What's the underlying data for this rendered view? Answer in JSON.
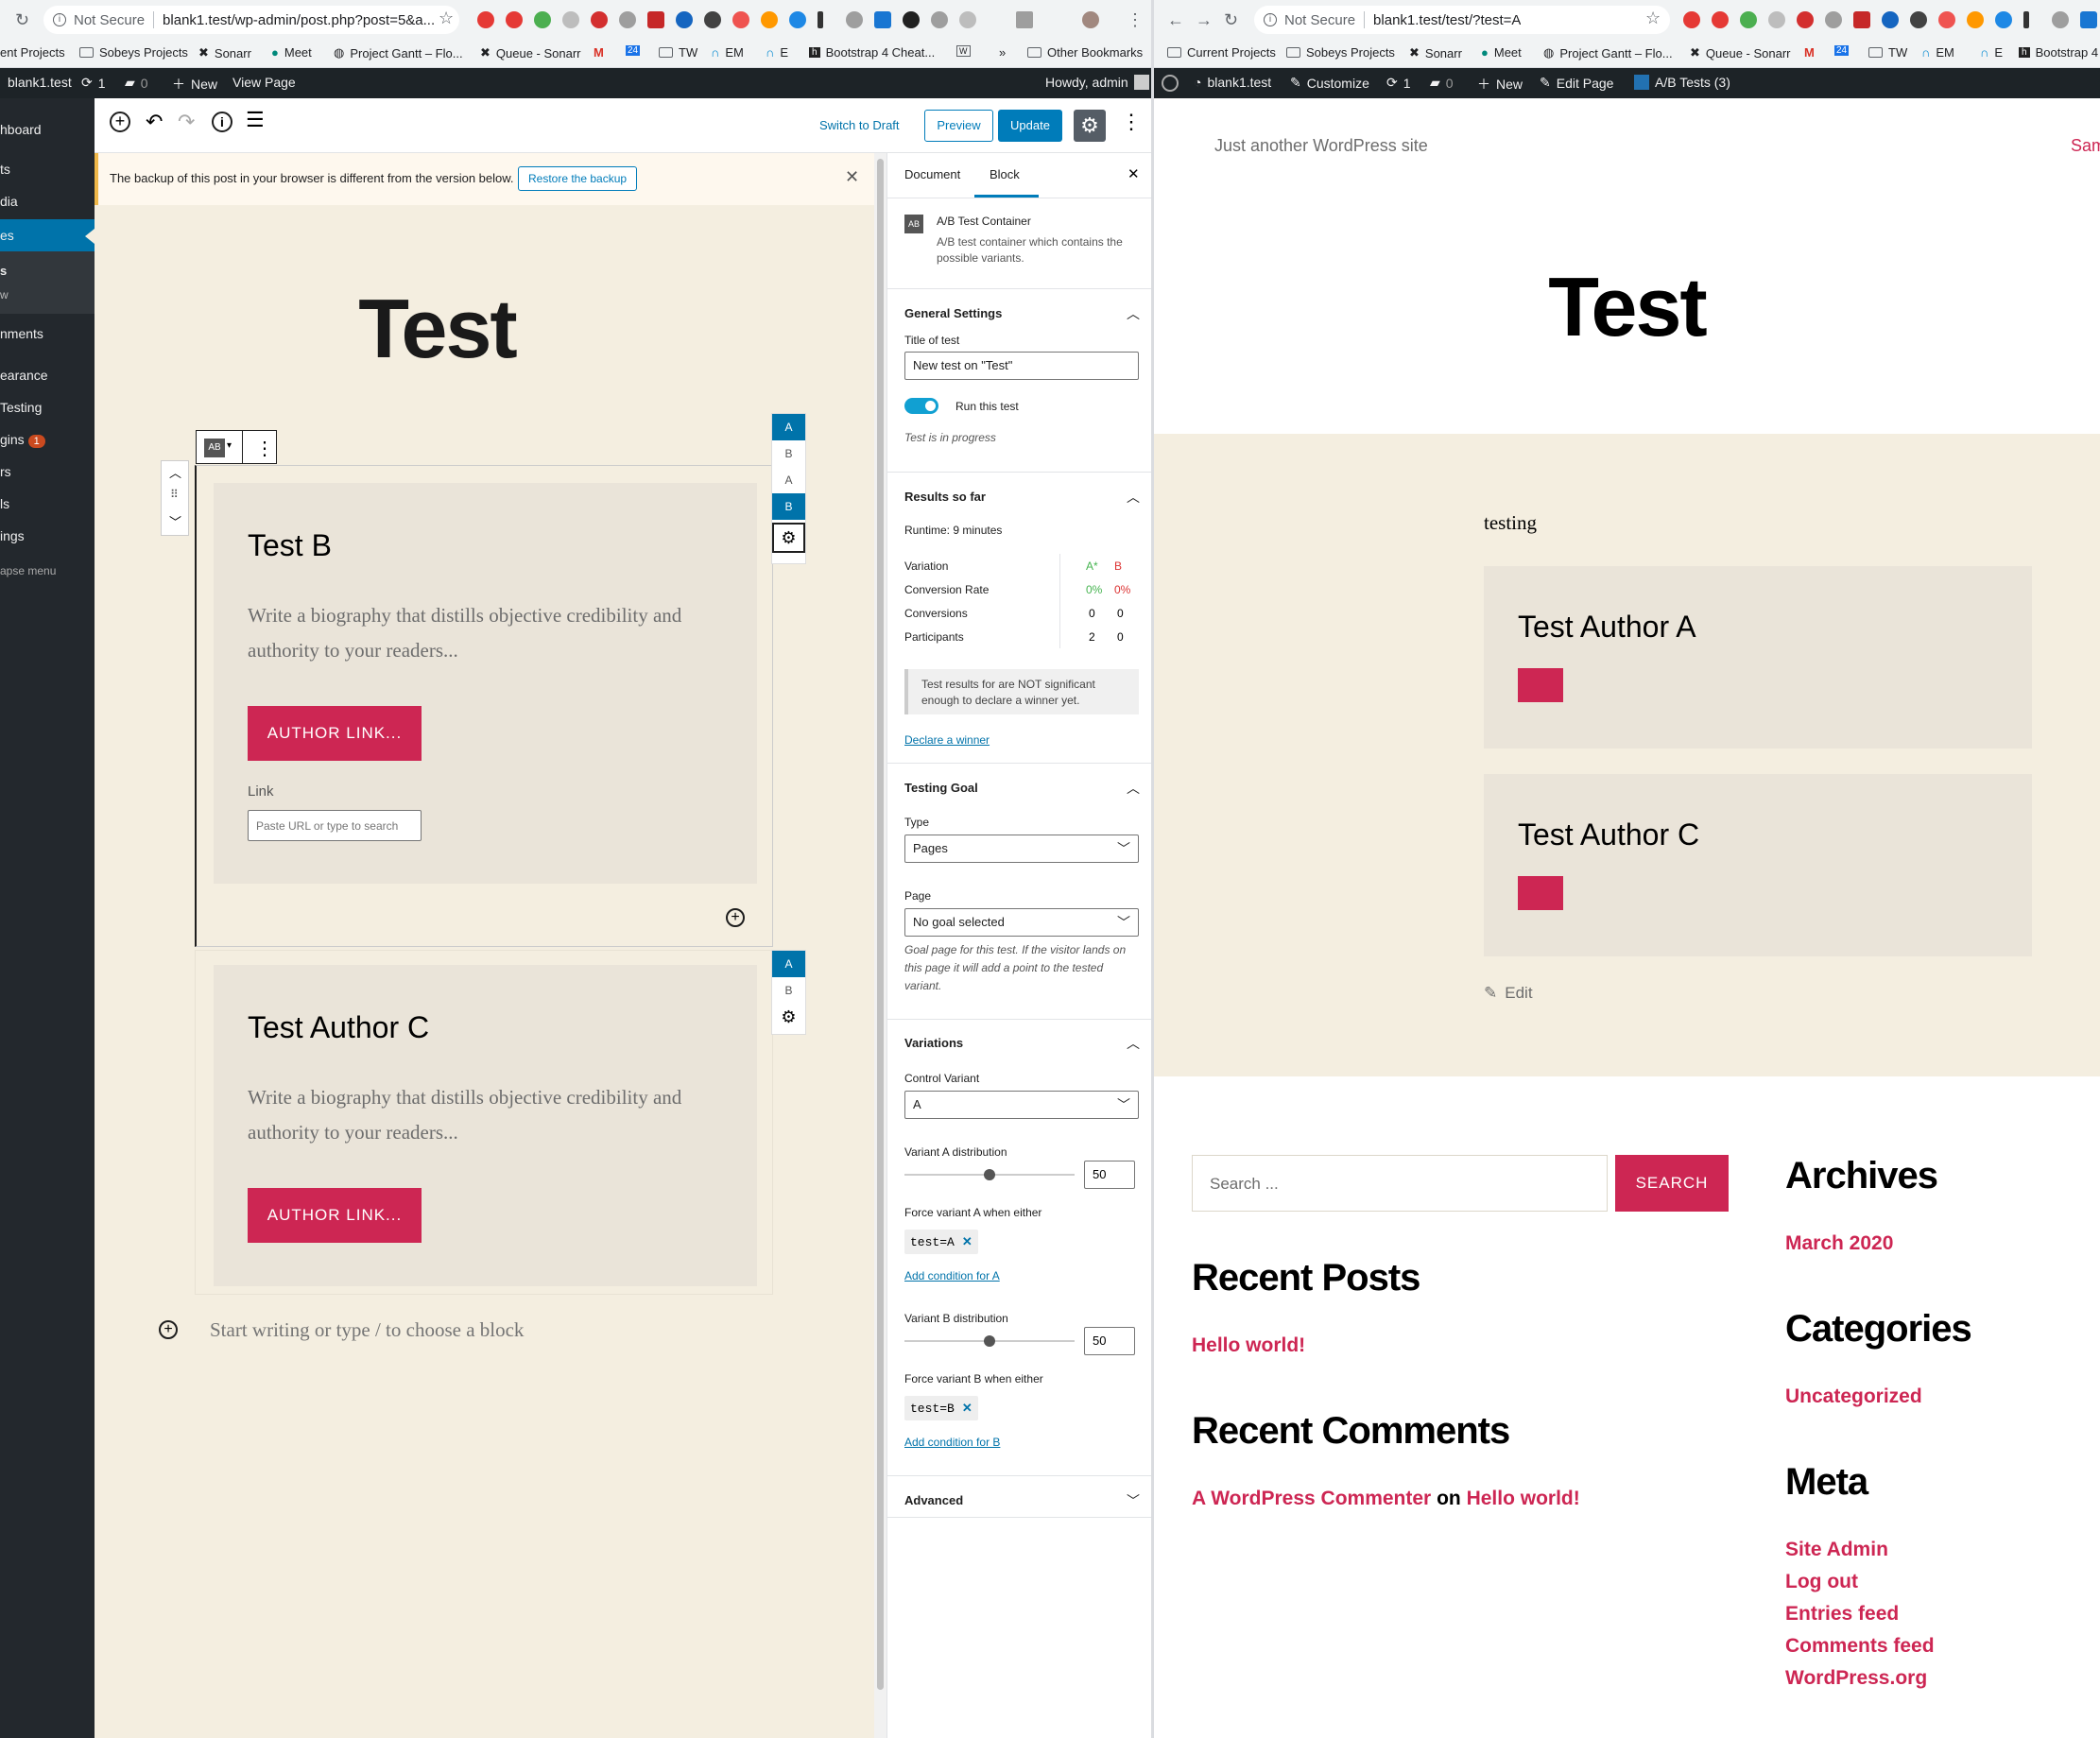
{
  "left_browser": {
    "security": "Not Secure",
    "url": "blank1.test/wp-admin/post.php?post=5&a...",
    "bookmarks": [
      "ent Projects",
      "Sobeys Projects",
      "Sonarr",
      "Meet",
      "Project Gantt – Flo...",
      "Queue - Sonarr",
      "TW",
      "EM",
      "E",
      "Bootstrap 4 Cheat..."
    ],
    "more_bookmarks": "»",
    "other_bookmarks": "Other Bookmarks"
  },
  "right_browser": {
    "security": "Not Secure",
    "url": "blank1.test/test/?test=A",
    "bookmarks": [
      "Current Projects",
      "Sobeys Projects",
      "Sonarr",
      "Meet",
      "Project Gantt – Flo...",
      "Queue - Sonarr",
      "TW",
      "EM",
      "E",
      "Bootstrap 4"
    ]
  },
  "admin_bar_left": {
    "site": "blank1.test",
    "updates": "1",
    "comments": "0",
    "new": "New",
    "view_page": "View Page",
    "howdy": "Howdy, admin"
  },
  "admin_bar_right": {
    "site": "blank1.test",
    "customize": "Customize",
    "updates": "1",
    "comments": "0",
    "new": "New",
    "edit_page": "Edit Page",
    "ab_tests": "A/B Tests (3)"
  },
  "sidebar": {
    "items": [
      "hboard",
      "ts",
      "dia",
      "es",
      "s",
      "w",
      "nments",
      "earance",
      "Testing",
      "gins",
      "rs",
      "ls",
      "ings",
      "apse menu"
    ],
    "plugins_badge": "1"
  },
  "editor_toolbar": {
    "switch_to_draft": "Switch to Draft",
    "preview": "Preview",
    "update": "Update"
  },
  "notice": {
    "text": "The backup of this post in your browser is different from the version below.",
    "restore": "Restore the backup"
  },
  "editor": {
    "post_title": "Test",
    "block_icon": "AB",
    "card_b": {
      "heading": "Test B",
      "bio": "Write a biography that distills objective credibility and authority to your readers...",
      "button": "AUTHOR LINK...",
      "link_label": "Link",
      "link_placeholder": "Paste URL or type to search"
    },
    "card_c": {
      "heading": "Test Author C",
      "bio": "Write a biography that distills objective credibility and authority to your readers...",
      "button": "AUTHOR LINK..."
    },
    "variant_tabs_1": [
      "A",
      "B",
      "A",
      "B"
    ],
    "variant_tabs_2": [
      "A",
      "B"
    ],
    "appender_placeholder": "Start writing or type / to choose a block"
  },
  "inspector": {
    "tab_document": "Document",
    "tab_block": "Block",
    "block_name": "A/B Test Container",
    "block_desc": "A/B test container which contains the possible variants.",
    "general": {
      "heading": "General Settings",
      "title_label": "Title of test",
      "title_value": "New test on \"Test\"",
      "toggle_label": "Run this test",
      "status": "Test is in progress"
    },
    "results": {
      "heading": "Results so far",
      "runtime": "Runtime: 9 minutes",
      "rows": [
        {
          "label": "Variation",
          "a": "A*",
          "b": "B"
        },
        {
          "label": "Conversion Rate",
          "a": "0%",
          "b": "0%"
        },
        {
          "label": "Conversions",
          "a": "0",
          "b": "0"
        },
        {
          "label": "Participants",
          "a": "2",
          "b": "0"
        }
      ],
      "note": "Test results for are NOT significant enough to declare a winner yet.",
      "declare": "Declare a winner"
    },
    "goal": {
      "heading": "Testing Goal",
      "type_label": "Type",
      "type_value": "Pages",
      "page_label": "Page",
      "page_value": "No goal selected",
      "help": "Goal page for this test. If the visitor lands on this page it will add a point to the tested variant."
    },
    "variations": {
      "heading": "Variations",
      "control_label": "Control Variant",
      "control_value": "A",
      "a_dist_label": "Variant A distribution",
      "a_dist": "50",
      "a_force_label": "Force variant A when either",
      "a_tag": "test=A",
      "a_add": "Add condition for A",
      "b_dist_label": "Variant B distribution",
      "b_dist": "50",
      "b_force_label": "Force variant B when either",
      "b_tag": "test=B",
      "b_add": "Add condition for B"
    },
    "advanced": "Advanced"
  },
  "frontend": {
    "tagline": "Just another WordPress site",
    "menu_cut": "Sam",
    "page_title": "Test",
    "content_text": "testing",
    "card_a": "Test Author A",
    "card_c": "Test Author C",
    "edit": "Edit",
    "search_placeholder": "Search ...",
    "search_button": "SEARCH",
    "recent_posts_h": "Recent Posts",
    "recent_post": "Hello world!",
    "recent_comments_h": "Recent Comments",
    "commenter": "A WordPress Commenter",
    "comment_on": "on",
    "comment_post": "Hello world!",
    "archives_h": "Archives",
    "archive": "March 2020",
    "categories_h": "Categories",
    "category": "Uncategorized",
    "meta_h": "Meta",
    "meta_links": [
      "Site Admin",
      "Log out",
      "Entries feed",
      "Comments feed",
      "WordPress.org"
    ]
  },
  "colors": {
    "accent": "#cd2653",
    "wp_blue": "#007cba",
    "admin_dark": "#1d2327",
    "cream": "#f4eee0",
    "card": "#eae4d9"
  }
}
